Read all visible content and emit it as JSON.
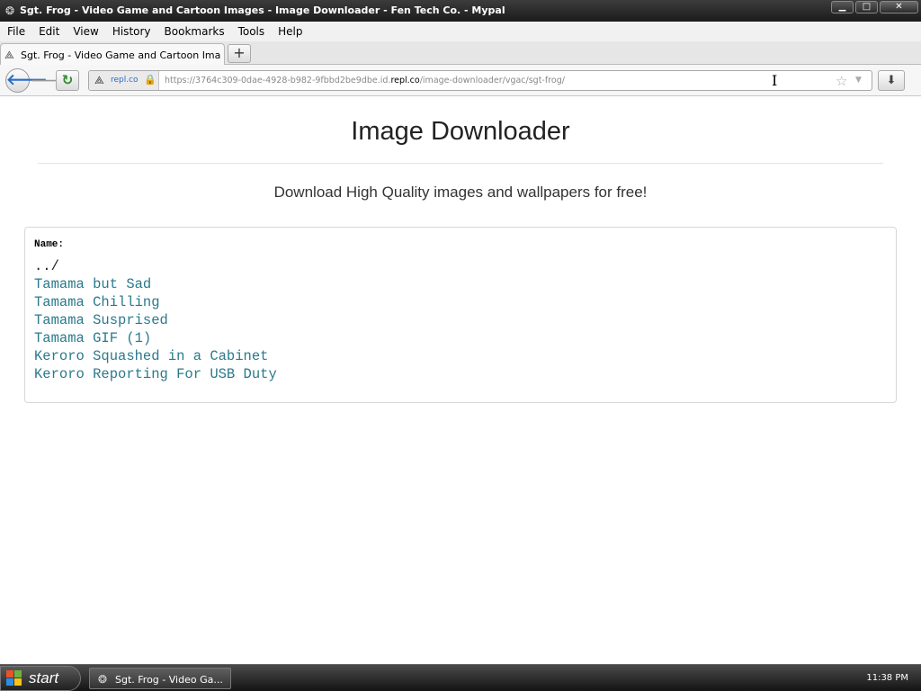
{
  "window": {
    "title": "Sgt. Frog - Video Game and Cartoon Images - Image Downloader - Fen Tech Co. - Mypal",
    "app_icon": "mypal-icon",
    "controls": {
      "minimize": "▁",
      "maximize": "□",
      "close": "✕"
    }
  },
  "menu": [
    "File",
    "Edit",
    "View",
    "History",
    "Bookmarks",
    "Tools",
    "Help"
  ],
  "tabs": [
    {
      "label": "Sgt. Frog - Video Game and Cartoon Images ...",
      "icon": "repl-icon",
      "active": true
    }
  ],
  "new_tab_label": "+",
  "nav": {
    "site_identity": "repl.co",
    "url_prefix": "https://3764c309-0dae-4928-b982-9fbbd2be9dbe.id.",
    "url_host": "repl.co",
    "url_path": "/image-downloader/vgac/sgt-frog/"
  },
  "page": {
    "title": "Image Downloader",
    "subtitle": "Download High Quality images and wallpapers for free!",
    "listing_header": "Name:",
    "parent_link": "../",
    "files": [
      "Tamama but Sad",
      "Tamama Chilling",
      "Tamama Susprised",
      "Tamama GIF (1)",
      "Keroro Squashed in a Cabinet",
      "Keroro Reporting For USB Duty"
    ],
    "link_color": "#2a7a8c"
  },
  "taskbar": {
    "start_label": "start",
    "items": [
      {
        "label": "Sgt. Frog - Video Ga...",
        "icon": "mypal-icon"
      }
    ],
    "clock": "11:38 PM"
  }
}
